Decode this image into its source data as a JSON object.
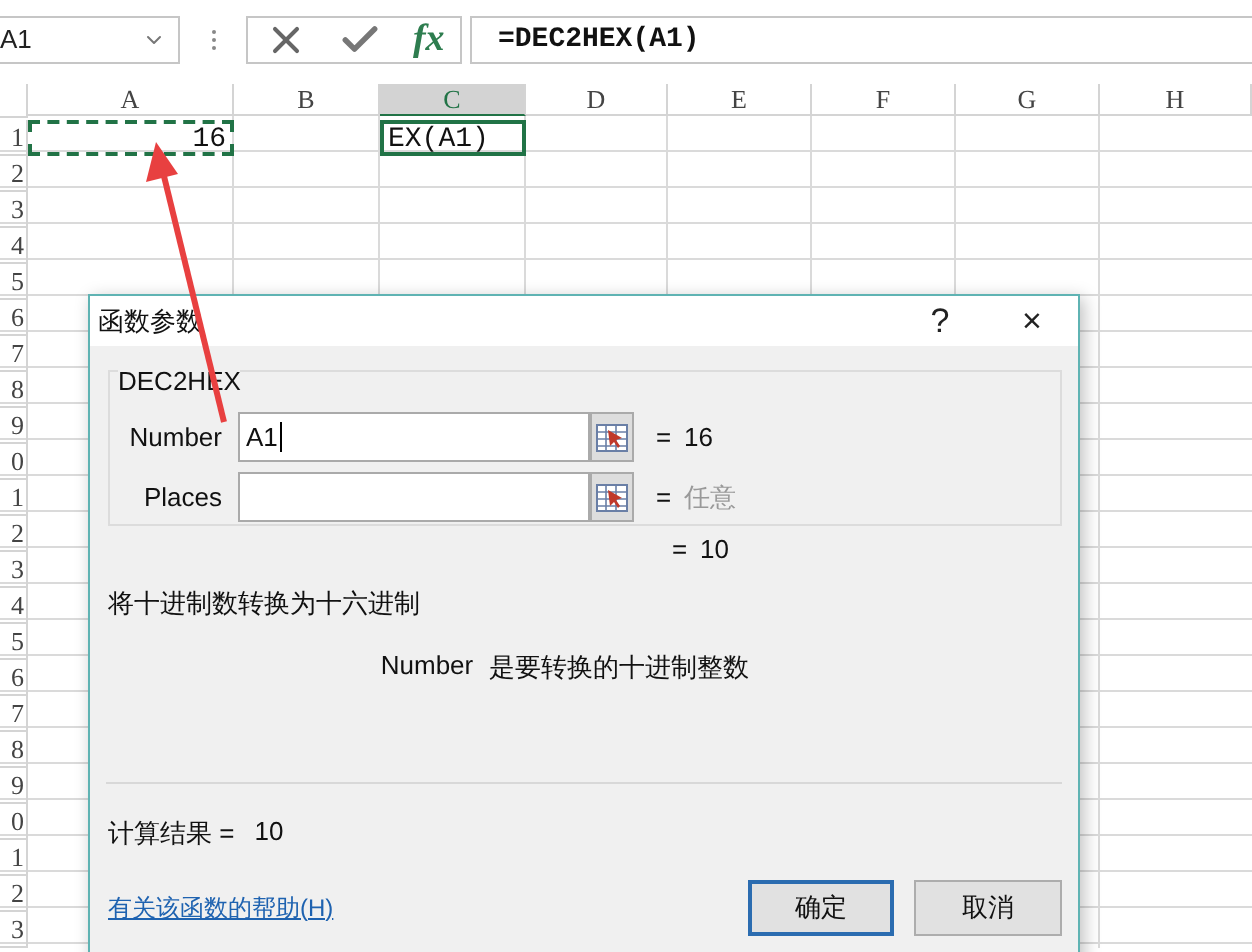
{
  "formula_bar": {
    "name_box": "A1",
    "fx": "fx",
    "formula": "=DEC2HEX(A1)"
  },
  "grid": {
    "columns": [
      {
        "label": "A",
        "selected": false
      },
      {
        "label": "B",
        "selected": false
      },
      {
        "label": "C",
        "selected": true
      },
      {
        "label": "D",
        "selected": false
      },
      {
        "label": "E",
        "selected": false
      },
      {
        "label": "F",
        "selected": false
      },
      {
        "label": "G",
        "selected": false
      },
      {
        "label": "H",
        "selected": false
      }
    ],
    "first_row_cells": [
      {
        "text": "16",
        "kind": "copied"
      },
      {
        "kind": "plain"
      },
      {
        "text": "EX(A1)",
        "kind": "editing"
      },
      {
        "kind": "plain"
      },
      {
        "kind": "plain"
      },
      {
        "kind": "plain"
      },
      {
        "kind": "plain"
      },
      {
        "kind": "plain"
      }
    ],
    "row_labels": [
      "1",
      "2",
      "3",
      "4",
      "5",
      "6",
      "7",
      "8",
      "9",
      "0",
      "1",
      "2",
      "3",
      "4",
      "5",
      "6",
      "7",
      "8",
      "9",
      "0",
      "1",
      "2",
      "3"
    ]
  },
  "dialog": {
    "title": "函数参数",
    "help": "?",
    "close": "×",
    "group_title": "DEC2HEX",
    "arguments": [
      {
        "label": "Number",
        "value": "A1",
        "focused": true,
        "equals": "=",
        "result": "16",
        "muted": false
      },
      {
        "label": "Places",
        "focused": false,
        "equals": "=",
        "result": "任意",
        "muted": true
      }
    ],
    "formula_result": {
      "equals": "=",
      "value": "10"
    },
    "description": "将十进制数转换为十六进制",
    "argument_help": {
      "name": "Number",
      "text": "是要转换的十进制整数"
    },
    "calc_result": {
      "label": "计算结果 =",
      "value": "10"
    },
    "help_link": "有关该函数的帮助(H)",
    "buttons": [
      {
        "label": "确定",
        "default": true
      },
      {
        "label": "取消",
        "default": false
      }
    ]
  }
}
